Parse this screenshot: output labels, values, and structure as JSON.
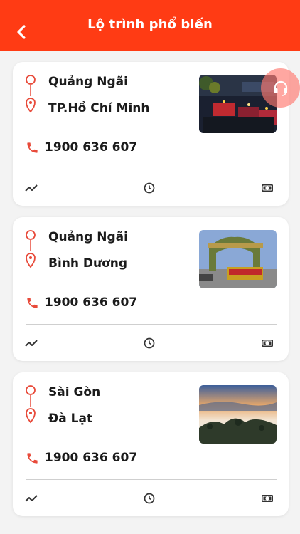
{
  "header": {
    "title": "Lộ trình phổ biến"
  },
  "accent_color": "#ff3b14",
  "routes": [
    {
      "from": "Quảng Ngãi",
      "to": "TP.Hồ Chí Minh",
      "phone": "1900 636 607",
      "image": "night-bus-station"
    },
    {
      "from": "Quảng Ngãi",
      "to": "Bình Dương",
      "phone": "1900 636 607",
      "image": "gate-with-bus"
    },
    {
      "from": "Sài Gòn",
      "to": "Đà Lạt",
      "phone": "1900 636 607",
      "image": "misty-hills"
    }
  ]
}
